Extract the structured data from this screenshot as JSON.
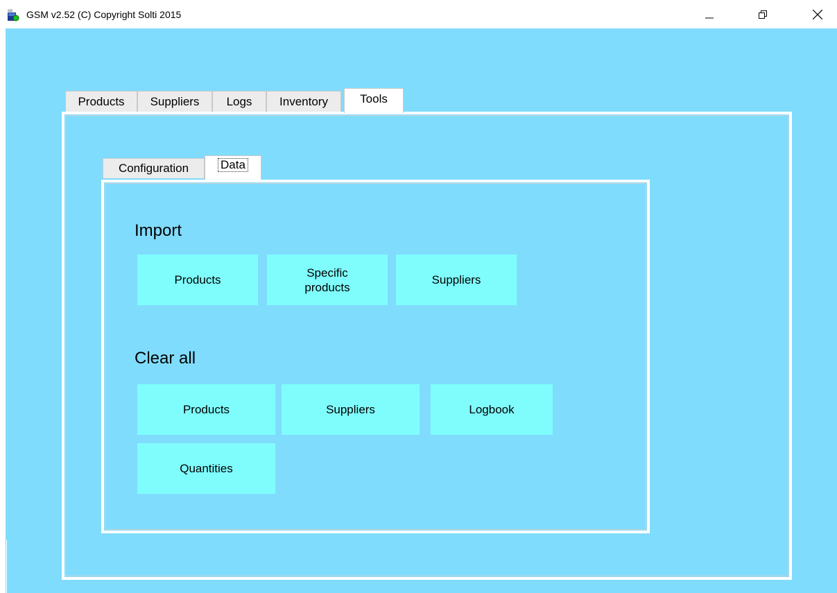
{
  "window": {
    "title": "GSM v2.52 (C) Copyright Solti 2015",
    "controls": [
      "minimize",
      "restore",
      "close"
    ]
  },
  "main_tabs": [
    {
      "label": "Products",
      "active": false
    },
    {
      "label": "Suppliers",
      "active": false
    },
    {
      "label": "Logs",
      "active": false
    },
    {
      "label": "Inventory",
      "active": false
    },
    {
      "label": "Tools",
      "active": true
    }
  ],
  "tools_tabs": [
    {
      "label": "Configuration",
      "active": false
    },
    {
      "label": "Data",
      "active": true
    }
  ],
  "import": {
    "heading": "Import",
    "buttons": [
      "Products",
      "Specific\nproducts",
      "Suppliers"
    ]
  },
  "clear_all": {
    "heading": "Clear all",
    "buttons": [
      "Products",
      "Suppliers",
      "Logbook",
      "Quantities"
    ]
  },
  "colors": {
    "background": "#80dcfd",
    "button": "#7ffdfd",
    "panel_border": "#ffffff"
  }
}
